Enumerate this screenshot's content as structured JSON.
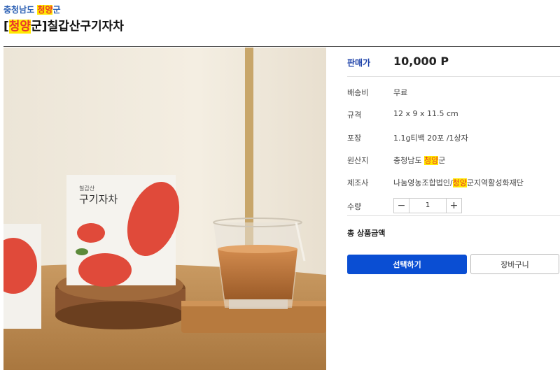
{
  "breadcrumb": {
    "prefix": "충청남도 ",
    "highlight": "청양",
    "suffix": "군"
  },
  "product": {
    "bracket_open": "[",
    "title_highlight": "청양",
    "title_rest": "군]칠갑산구기자차"
  },
  "photo": {
    "box_brand": "칠갑산",
    "box_title": "구기자차"
  },
  "details": {
    "price_label": "판매가",
    "price_value": "10,000 P",
    "shipping_label": "배송비",
    "shipping_value": "무료",
    "size_label": "규격",
    "size_value": "12 x 9 x 11.5 cm",
    "package_label": "포장",
    "package_value": "1.1g티백 20포 /1상자",
    "origin_label": "원산지",
    "origin_prefix": "충청남도 ",
    "origin_highlight": "청양",
    "origin_suffix": "군",
    "maker_label": "제조사",
    "maker_prefix": "나눔영농조합법인/",
    "maker_highlight": "청양",
    "maker_suffix": "군지역활성화재단",
    "qty_label": "수량",
    "qty_minus": "−",
    "qty_value": "1",
    "qty_plus": "+",
    "total_label": "총 상품금액"
  },
  "actions": {
    "select_label": "선택하기",
    "cart_label": "장바구니"
  },
  "colors": {
    "accent": "#0a4ed3",
    "highlight_bg": "#ffe800",
    "highlight_fg": "#e8382b",
    "region": "#2b5fb3"
  }
}
